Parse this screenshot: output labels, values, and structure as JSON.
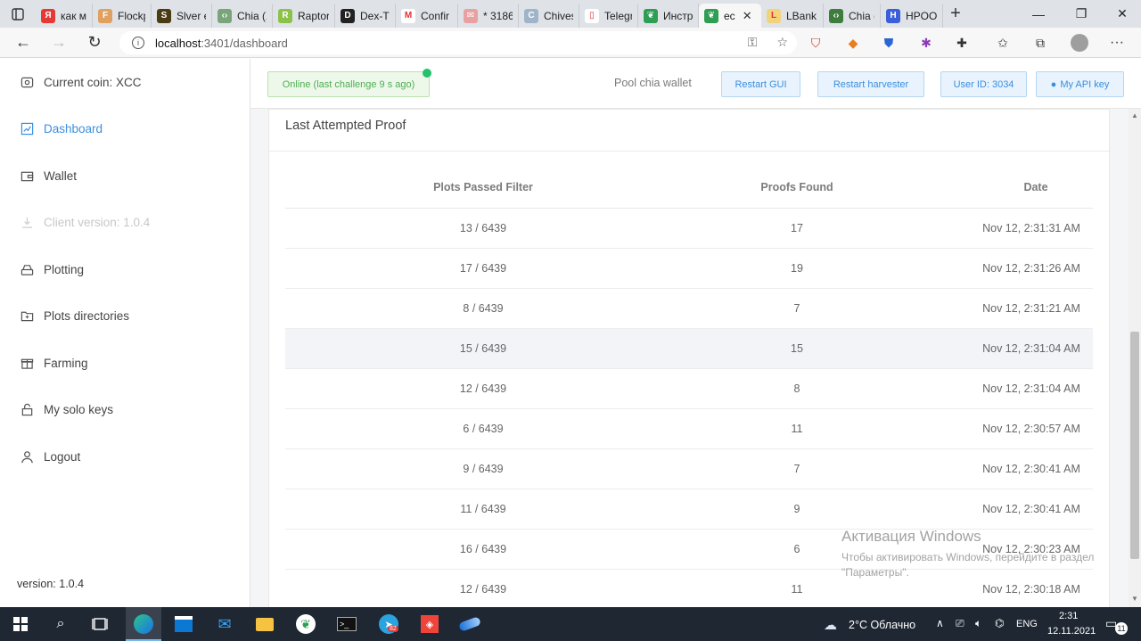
{
  "browser": {
    "tabs": [
      {
        "label": "как ма",
        "icon": "yandex-icon",
        "color": "#e53935",
        "glyph": "Я"
      },
      {
        "label": "Flockp",
        "icon": "flockpool-icon",
        "color": "#e0a060",
        "glyph": "F"
      },
      {
        "label": "Slver e",
        "icon": "slver-icon",
        "color": "#4a3b12",
        "glyph": "S"
      },
      {
        "label": "Chia (X",
        "icon": "code-icon",
        "color": "#7aa57a",
        "glyph": "‹›"
      },
      {
        "label": "Raptor",
        "icon": "raptor-icon",
        "color": "#8bc34a",
        "glyph": "R"
      },
      {
        "label": "Dex-Tr",
        "icon": "dextrade-icon",
        "color": "#222222",
        "glyph": "D"
      },
      {
        "label": "Confir",
        "icon": "gmail-icon",
        "color": "#ffffff",
        "glyph": "M"
      },
      {
        "label": "* 3186",
        "icon": "mail-icon",
        "color": "#e8a0a0",
        "glyph": "✉"
      },
      {
        "label": "Chives",
        "icon": "chives-icon",
        "color": "#9fb4c8",
        "glyph": "C"
      },
      {
        "label": "Telegra",
        "icon": "document-icon",
        "color": "#ffffff",
        "glyph": "▯"
      },
      {
        "label": "Инстр",
        "icon": "leaf-icon",
        "color": "#2e9e55",
        "glyph": "❦"
      },
      {
        "label": "ec",
        "icon": "leaf-icon",
        "color": "#2e9e55",
        "glyph": "❦",
        "active": true
      },
      {
        "label": "LBank",
        "icon": "lbank-icon",
        "color": "#f2d27a",
        "glyph": "L"
      },
      {
        "label": "Chia (X",
        "icon": "code-icon",
        "color": "#3f7d3f",
        "glyph": "‹›"
      },
      {
        "label": "HPOO",
        "icon": "hpool-icon",
        "color": "#3b5fd9",
        "glyph": "H"
      }
    ],
    "new_tab": "+",
    "window_controls": {
      "minimize": "—",
      "restore": "❐",
      "close": "✕"
    },
    "url_host": "localhost",
    "url_path": ":3401/dashboard"
  },
  "sidebar": {
    "items": [
      {
        "label": "Current coin: XCC",
        "icon": "coin-icon",
        "state": "normal"
      },
      {
        "label": "Dashboard",
        "icon": "chart-icon",
        "state": "active"
      },
      {
        "label": "Wallet",
        "icon": "wallet-icon",
        "state": "normal"
      },
      {
        "label": "Client version: 1.0.4",
        "icon": "download-icon",
        "state": "muted"
      },
      {
        "label": "Plotting",
        "icon": "hdd-icon",
        "state": "normal"
      },
      {
        "label": "Plots directories",
        "icon": "folder-icon",
        "state": "normal"
      },
      {
        "label": "Farming",
        "icon": "gift-icon",
        "state": "normal"
      },
      {
        "label": "My solo keys",
        "icon": "lock-icon",
        "state": "normal"
      },
      {
        "label": "Logout",
        "icon": "user-icon",
        "state": "normal"
      }
    ],
    "version": "version: 1.0.4"
  },
  "topbar": {
    "status": "Online (last challenge 9 s ago)",
    "pool_wallet": "Pool chia wallet",
    "restart_gui": "Restart GUI",
    "restart_harvester": "Restart harvester",
    "user_id": "User ID: 3034",
    "api_key": "My API key"
  },
  "proof_card": {
    "title": "Last Attempted Proof",
    "columns": [
      "Plots Passed Filter",
      "Proofs Found",
      "Date"
    ],
    "rows": [
      {
        "filter": "13 / 6439",
        "proofs": "17",
        "date": "Nov 12, 2:31:31 AM"
      },
      {
        "filter": "17 / 6439",
        "proofs": "19",
        "date": "Nov 12, 2:31:26 AM"
      },
      {
        "filter": "8 / 6439",
        "proofs": "7",
        "date": "Nov 12, 2:31:21 AM"
      },
      {
        "filter": "15 / 6439",
        "proofs": "15",
        "date": "Nov 12, 2:31:04 AM",
        "highlight": true
      },
      {
        "filter": "12 / 6439",
        "proofs": "8",
        "date": "Nov 12, 2:31:04 AM"
      },
      {
        "filter": "6 / 6439",
        "proofs": "11",
        "date": "Nov 12, 2:30:57 AM"
      },
      {
        "filter": "9 / 6439",
        "proofs": "7",
        "date": "Nov 12, 2:30:41 AM"
      },
      {
        "filter": "11 / 6439",
        "proofs": "9",
        "date": "Nov 12, 2:30:41 AM"
      },
      {
        "filter": "16 / 6439",
        "proofs": "6",
        "date": "Nov 12, 2:30:23 AM"
      },
      {
        "filter": "12 / 6439",
        "proofs": "11",
        "date": "Nov 12, 2:30:18 AM"
      }
    ]
  },
  "watermark": {
    "line1": "Активация Windows",
    "line2": "Чтобы активировать Windows, перейдите в раздел \"Параметры\"."
  },
  "taskbar": {
    "weather": "2°C  Облачно",
    "lang": "ENG",
    "time": "2:31",
    "date": "12.11.2021",
    "telegram_badge": "82",
    "notifications": "11"
  },
  "colors": {
    "accent": "#3d8fe0",
    "online_green": "#4caf50",
    "online_dot": "#22c26b",
    "taskbar": "#1f2733"
  }
}
